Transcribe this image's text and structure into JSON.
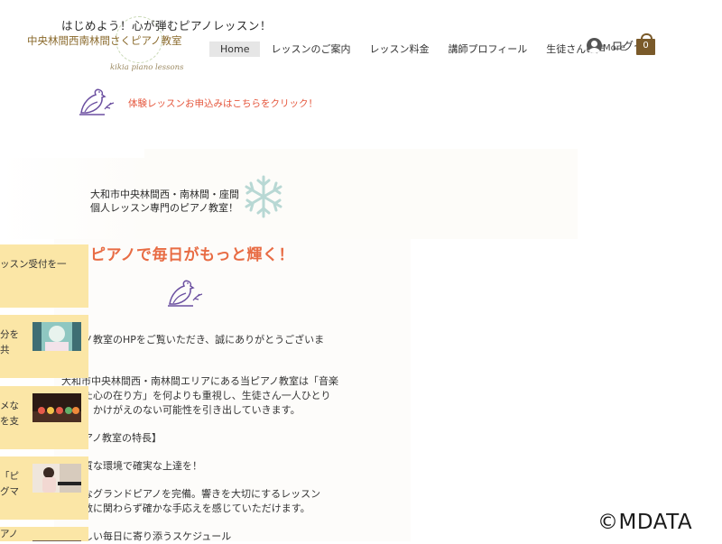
{
  "header": {
    "tagline": "はじめよう！心が弾むピアノレッスン！",
    "school_name": "中央林間西南林間さくピアノ教室",
    "logo_script": "kikia piano lessons",
    "nav": [
      {
        "label": "Home",
        "active": true
      },
      {
        "label": "レッスンのご案内",
        "active": false
      },
      {
        "label": "レッスン料金",
        "active": false
      },
      {
        "label": "講師プロフィール",
        "active": false
      },
      {
        "label": "生徒さんの声",
        "active": false
      }
    ],
    "login_label": "ログイ",
    "more_label": "More",
    "cart_count": "0"
  },
  "trial_link": "体験レッスンお申込みはこちらをクリック！",
  "hero": {
    "line1": "大和市中央林間西・南林間・座間",
    "line2": "個人レッスン専門のピアノ教室！"
  },
  "main": {
    "headline": "ピアノで毎日がもっと輝く！",
    "paragraphs": [
      "ノ教室のHPをご覧いただき、誠にありがとうございま",
      "大和市中央林間西・南林間エリアにある当ピアノ教室は「音楽",
      "た心の在り方」を何よりも重視し、生徒さん一人ひとり",
      "、かけがえのない可能性を引き出していきます。",
      "アノ教室の特長】",
      "質な環境で確実な上達を！",
      "なグランドピアノを完備。響きを大切にするレッスン",
      "数に関わらず確かな手応えを感じていただけます。",
      "しい毎日に寄り添うスケジュール"
    ]
  },
  "side_cards": [
    {
      "line1": "ッスン受付を一",
      "line2": ""
    },
    {
      "line1": "分を",
      "line2": "共"
    },
    {
      "line1": "メな",
      "line2": "を支"
    },
    {
      "line1": "「ピ",
      "line2": "グマ"
    },
    {
      "line1": "アノ",
      "line2": ""
    }
  ],
  "copyright": "©MDATA",
  "colors": {
    "accent_orange": "#e86c44",
    "link_red": "#e5563c",
    "card_yellow": "#fbe6a6",
    "brand_brown": "#7a5a2a",
    "bird_purple": "#6b4fa0"
  }
}
